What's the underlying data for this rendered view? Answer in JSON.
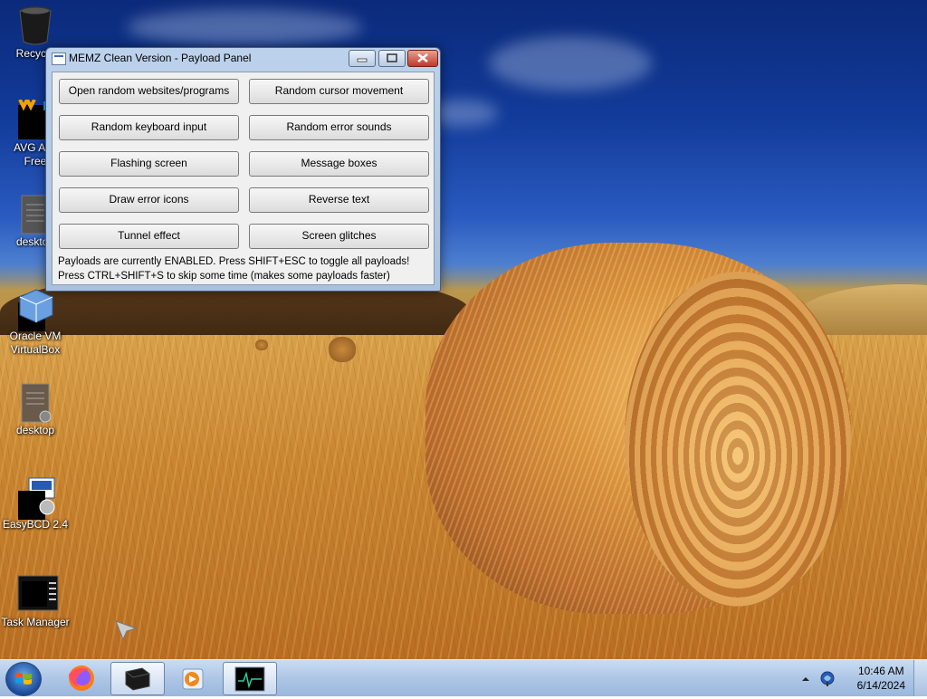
{
  "desktop": {
    "icons": [
      {
        "label": "Recycle"
      },
      {
        "label": "AVG Anti"
      },
      {
        "label": "Free"
      },
      {
        "label": "desktop"
      },
      {
        "label": "Oracle VM"
      },
      {
        "label": "VirtualBox"
      },
      {
        "label": "desktop"
      },
      {
        "label": "EasyBCD 2.4"
      },
      {
        "label": "Task Manager"
      }
    ]
  },
  "window": {
    "title": "MEMZ Clean Version - Payload Panel",
    "controls": {
      "minimize": "minimize",
      "maximize": "maximize",
      "close": "close"
    },
    "buttons": [
      {
        "label": "Open random websites/programs"
      },
      {
        "label": "Random cursor movement"
      },
      {
        "label": "Random keyboard input"
      },
      {
        "label": "Random error sounds"
      },
      {
        "label": "Flashing screen"
      },
      {
        "label": "Message boxes"
      },
      {
        "label": "Draw error icons"
      },
      {
        "label": "Reverse text"
      },
      {
        "label": "Tunnel effect"
      },
      {
        "label": "Screen glitches"
      }
    ],
    "status_line1": "Payloads are currently ENABLED. Press SHIFT+ESC to toggle all payloads!",
    "status_line2": "Press CTRL+SHIFT+S to skip some time (makes some payloads faster)"
  },
  "taskbar": {
    "items": [
      {
        "name": "firefox-icon"
      },
      {
        "name": "memz-icon"
      },
      {
        "name": "media-player-icon"
      },
      {
        "name": "task-manager-icon"
      }
    ],
    "time": "10:46 AM",
    "date": "6/14/2024"
  }
}
